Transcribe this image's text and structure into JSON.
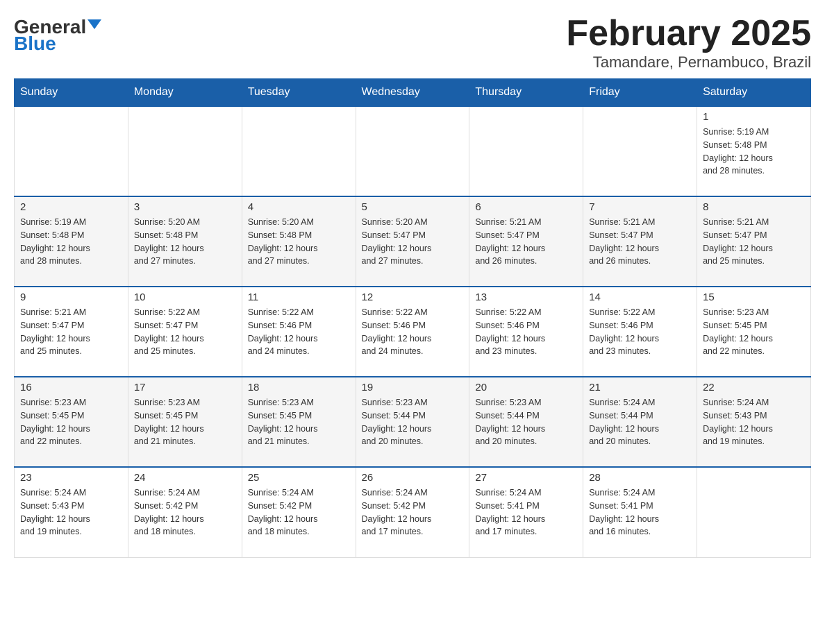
{
  "logo": {
    "text_general": "General",
    "text_blue": "Blue"
  },
  "title": "February 2025",
  "subtitle": "Tamandare, Pernambuco, Brazil",
  "days_of_week": [
    "Sunday",
    "Monday",
    "Tuesday",
    "Wednesday",
    "Thursday",
    "Friday",
    "Saturday"
  ],
  "weeks": [
    [
      {
        "day": "",
        "info": ""
      },
      {
        "day": "",
        "info": ""
      },
      {
        "day": "",
        "info": ""
      },
      {
        "day": "",
        "info": ""
      },
      {
        "day": "",
        "info": ""
      },
      {
        "day": "",
        "info": ""
      },
      {
        "day": "1",
        "info": "Sunrise: 5:19 AM\nSunset: 5:48 PM\nDaylight: 12 hours\nand 28 minutes."
      }
    ],
    [
      {
        "day": "2",
        "info": "Sunrise: 5:19 AM\nSunset: 5:48 PM\nDaylight: 12 hours\nand 28 minutes."
      },
      {
        "day": "3",
        "info": "Sunrise: 5:20 AM\nSunset: 5:48 PM\nDaylight: 12 hours\nand 27 minutes."
      },
      {
        "day": "4",
        "info": "Sunrise: 5:20 AM\nSunset: 5:48 PM\nDaylight: 12 hours\nand 27 minutes."
      },
      {
        "day": "5",
        "info": "Sunrise: 5:20 AM\nSunset: 5:47 PM\nDaylight: 12 hours\nand 27 minutes."
      },
      {
        "day": "6",
        "info": "Sunrise: 5:21 AM\nSunset: 5:47 PM\nDaylight: 12 hours\nand 26 minutes."
      },
      {
        "day": "7",
        "info": "Sunrise: 5:21 AM\nSunset: 5:47 PM\nDaylight: 12 hours\nand 26 minutes."
      },
      {
        "day": "8",
        "info": "Sunrise: 5:21 AM\nSunset: 5:47 PM\nDaylight: 12 hours\nand 25 minutes."
      }
    ],
    [
      {
        "day": "9",
        "info": "Sunrise: 5:21 AM\nSunset: 5:47 PM\nDaylight: 12 hours\nand 25 minutes."
      },
      {
        "day": "10",
        "info": "Sunrise: 5:22 AM\nSunset: 5:47 PM\nDaylight: 12 hours\nand 25 minutes."
      },
      {
        "day": "11",
        "info": "Sunrise: 5:22 AM\nSunset: 5:46 PM\nDaylight: 12 hours\nand 24 minutes."
      },
      {
        "day": "12",
        "info": "Sunrise: 5:22 AM\nSunset: 5:46 PM\nDaylight: 12 hours\nand 24 minutes."
      },
      {
        "day": "13",
        "info": "Sunrise: 5:22 AM\nSunset: 5:46 PM\nDaylight: 12 hours\nand 23 minutes."
      },
      {
        "day": "14",
        "info": "Sunrise: 5:22 AM\nSunset: 5:46 PM\nDaylight: 12 hours\nand 23 minutes."
      },
      {
        "day": "15",
        "info": "Sunrise: 5:23 AM\nSunset: 5:45 PM\nDaylight: 12 hours\nand 22 minutes."
      }
    ],
    [
      {
        "day": "16",
        "info": "Sunrise: 5:23 AM\nSunset: 5:45 PM\nDaylight: 12 hours\nand 22 minutes."
      },
      {
        "day": "17",
        "info": "Sunrise: 5:23 AM\nSunset: 5:45 PM\nDaylight: 12 hours\nand 21 minutes."
      },
      {
        "day": "18",
        "info": "Sunrise: 5:23 AM\nSunset: 5:45 PM\nDaylight: 12 hours\nand 21 minutes."
      },
      {
        "day": "19",
        "info": "Sunrise: 5:23 AM\nSunset: 5:44 PM\nDaylight: 12 hours\nand 20 minutes."
      },
      {
        "day": "20",
        "info": "Sunrise: 5:23 AM\nSunset: 5:44 PM\nDaylight: 12 hours\nand 20 minutes."
      },
      {
        "day": "21",
        "info": "Sunrise: 5:24 AM\nSunset: 5:44 PM\nDaylight: 12 hours\nand 20 minutes."
      },
      {
        "day": "22",
        "info": "Sunrise: 5:24 AM\nSunset: 5:43 PM\nDaylight: 12 hours\nand 19 minutes."
      }
    ],
    [
      {
        "day": "23",
        "info": "Sunrise: 5:24 AM\nSunset: 5:43 PM\nDaylight: 12 hours\nand 19 minutes."
      },
      {
        "day": "24",
        "info": "Sunrise: 5:24 AM\nSunset: 5:42 PM\nDaylight: 12 hours\nand 18 minutes."
      },
      {
        "day": "25",
        "info": "Sunrise: 5:24 AM\nSunset: 5:42 PM\nDaylight: 12 hours\nand 18 minutes."
      },
      {
        "day": "26",
        "info": "Sunrise: 5:24 AM\nSunset: 5:42 PM\nDaylight: 12 hours\nand 17 minutes."
      },
      {
        "day": "27",
        "info": "Sunrise: 5:24 AM\nSunset: 5:41 PM\nDaylight: 12 hours\nand 17 minutes."
      },
      {
        "day": "28",
        "info": "Sunrise: 5:24 AM\nSunset: 5:41 PM\nDaylight: 12 hours\nand 16 minutes."
      },
      {
        "day": "",
        "info": ""
      }
    ]
  ]
}
